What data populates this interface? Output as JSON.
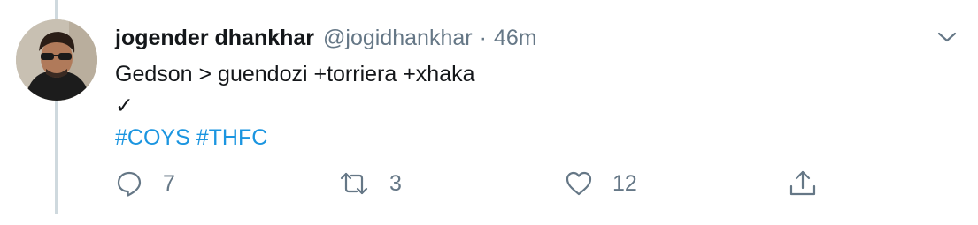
{
  "tweet": {
    "display_name": "jogender dhankhar",
    "handle": "@jogidhankhar",
    "separator": "·",
    "time": "46m",
    "text_line1": "Gedson > guendozi +torriera +xhaka",
    "text_line2": "✓",
    "hashtags": [
      "#COYS",
      "#THFC"
    ]
  },
  "actions": {
    "reply": {
      "icon": "reply-icon",
      "count": "7"
    },
    "retweet": {
      "icon": "retweet-icon",
      "count": "3"
    },
    "like": {
      "icon": "heart-icon",
      "count": "12"
    },
    "share": {
      "icon": "share-icon"
    }
  },
  "colors": {
    "text": "#14171a",
    "muted": "#657786",
    "link": "#1b95e0",
    "thread_line": "#cfd9de"
  }
}
